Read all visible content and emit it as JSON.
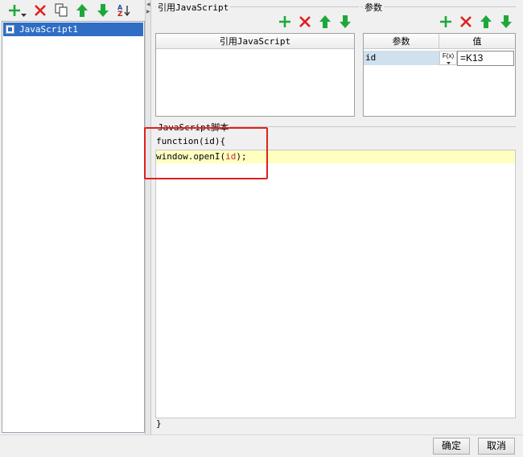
{
  "left_toolbar": {
    "add_icon": "plus-icon",
    "delete_icon": "x-icon",
    "copy_icon": "copy-icon",
    "up_icon": "arrow-up-icon",
    "down_icon": "arrow-down-icon",
    "sort_icon": "sort-az-icon"
  },
  "script_list": {
    "items": [
      {
        "label": "JavaScript1",
        "selected": true
      }
    ]
  },
  "js_reference": {
    "title": "引用JavaScript",
    "column_header": "引用JavaScript",
    "rows": []
  },
  "params": {
    "title": "参数",
    "col_param": "参数",
    "col_value": "值",
    "rows": [
      {
        "name": "id",
        "formula_button": "F(x)",
        "value": "=K13"
      }
    ]
  },
  "script_editor": {
    "title": "JavaScript脚本",
    "lines": [
      {
        "text": "function(id){"
      },
      {
        "prefix": "window.openI(",
        "arg": "id",
        "suffix": ");",
        "highlight": true
      }
    ],
    "closing": "}"
  },
  "footer": {
    "ok_label": "确定",
    "cancel_label": "取消"
  },
  "colors": {
    "selection": "#2f6ec4",
    "highlight_line": "#ffffc0",
    "annotation_box": "#e02020",
    "icon_green": "#1fa83a",
    "icon_red": "#e02020"
  }
}
